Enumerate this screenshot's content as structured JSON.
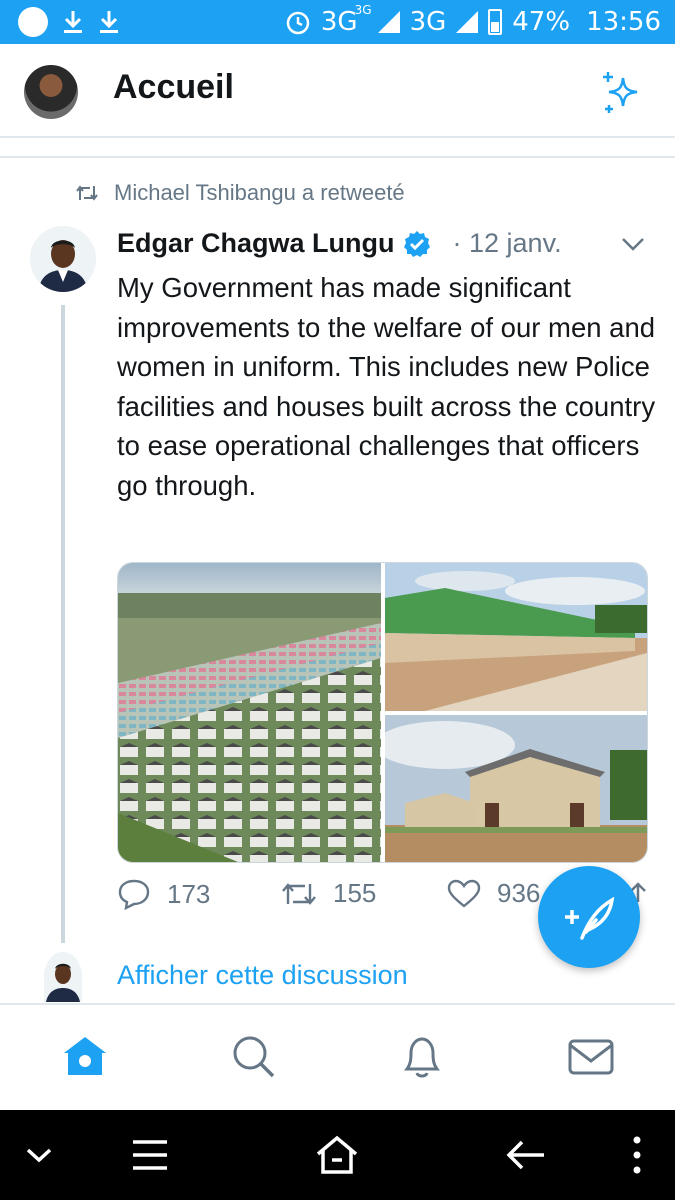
{
  "status_bar": {
    "network1": "3G",
    "network1_sup": "3G",
    "network2": "3G",
    "battery": "47%",
    "time": "13:56"
  },
  "header": {
    "title": "Accueil"
  },
  "tweet": {
    "retweet_label": "Michael Tshibangu a retweeté",
    "author_name": "Edgar Chagwa Lungu",
    "date": "· 12 janv.",
    "text": "My Government has made significant improvements to the welfare of our men and women in uniform. This includes new Police facilities and houses built across the country to ease operational challenges that officers go through.",
    "reply_count": "173",
    "retweet_count": "155",
    "like_count": "936"
  },
  "show_thread": "Afficher cette discussion",
  "colors": {
    "accent": "#1da1f2",
    "muted": "#657786",
    "text": "#14171a",
    "divider": "#e1e8ed"
  },
  "icons": {
    "header": [
      "avatar",
      "sparkle-icon"
    ],
    "bottom_nav": [
      "home-icon",
      "search-icon",
      "notifications-icon",
      "messages-icon"
    ],
    "system_nav": [
      "chevron-down-icon",
      "menu-icon",
      "home-outline-icon",
      "back-icon",
      "more-icon"
    ]
  }
}
